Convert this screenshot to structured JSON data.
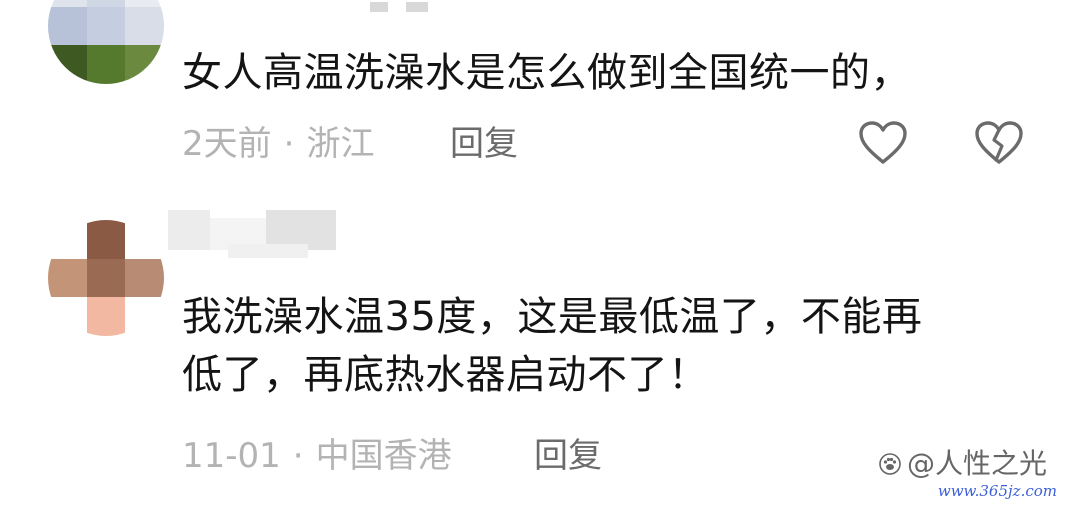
{
  "comments": [
    {
      "text": "女人高温洗澡水是怎么做到全国统一的，",
      "time": "2天前",
      "location": "浙江",
      "separator": "·",
      "reply_label": "回复"
    },
    {
      "text": "我洗澡水温35度，这是最低温了，不能再\n低了，再底热水器启动不了！",
      "time": "11-01",
      "location": "中国香港",
      "separator": "·",
      "reply_label": "回复"
    }
  ],
  "watermark": {
    "text": "@人性之光",
    "url": "www.365jz.com"
  },
  "colors": {
    "text": "#141414",
    "meta": "#b3b3b3",
    "reply": "#6b6b6b",
    "icon": "#6b6b6b",
    "watermark_url": "#3c5fd6"
  },
  "icons": {
    "like": "heart-outline-icon",
    "dislike": "broken-heart-icon",
    "watermark_logo": "paw-logo-icon"
  }
}
